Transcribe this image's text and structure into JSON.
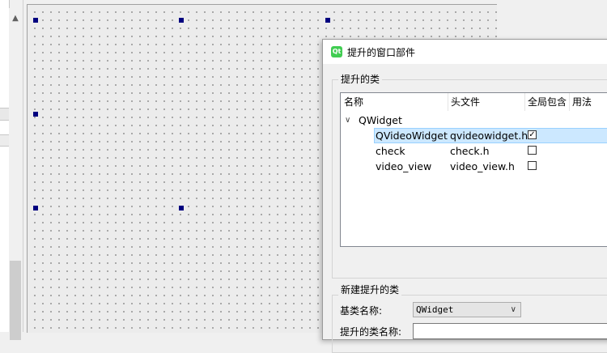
{
  "dialog": {
    "title": "提升的窗口部件",
    "logo_text": "Qt",
    "promoted_group_title": "提升的类",
    "columns": [
      "名称",
      "头文件",
      "全局包含",
      "用法"
    ],
    "tree": {
      "parent": "QWidget",
      "children": [
        {
          "name": "QVideoWidget",
          "header": "qvideowidget.h",
          "global_include": true,
          "selected": true
        },
        {
          "name": "check",
          "header": "check.h",
          "global_include": false,
          "selected": false
        },
        {
          "name": "video_view",
          "header": "video_view.h",
          "global_include": false,
          "selected": false
        }
      ]
    },
    "new_group_title": "新建提升的类",
    "base_class_label": "基类名称:",
    "base_class_value": "QWidget",
    "promoted_class_label": "提升的类名称:"
  },
  "icons": {
    "scroll_up": "chevron-up-icon",
    "expander": "chevron-down-icon",
    "combo": "chevron-down-icon",
    "check": "check-icon"
  },
  "colors": {
    "selection": "#cce8ff",
    "handle": "#00007f",
    "qt_green": "#41cd52"
  }
}
